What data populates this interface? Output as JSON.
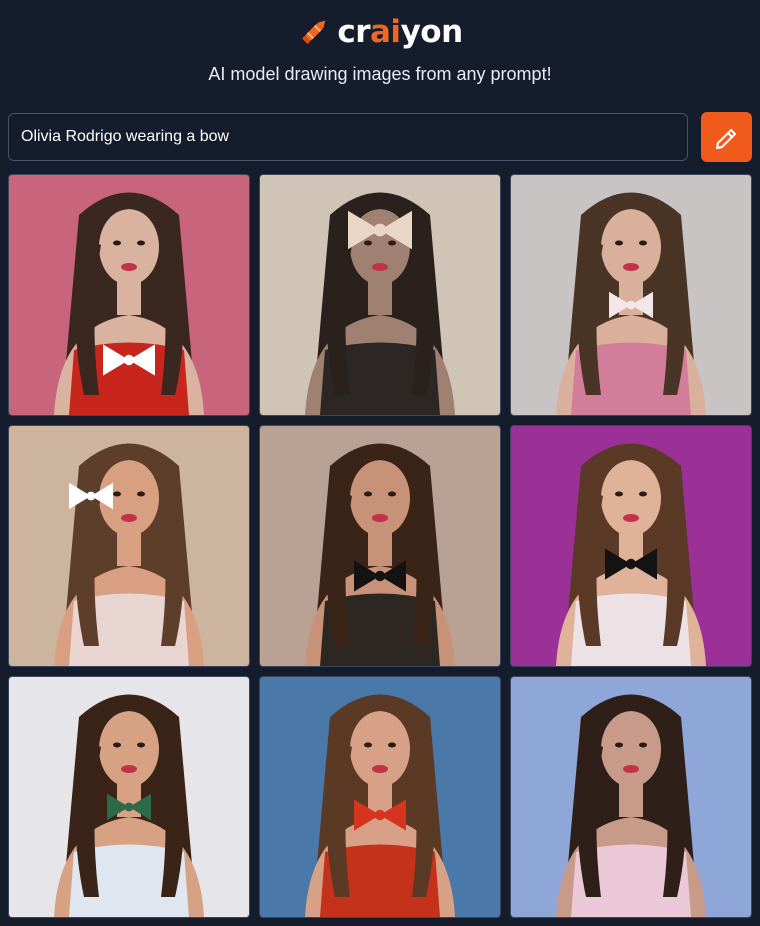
{
  "app": {
    "logo": {
      "part1": "cr",
      "accent": "ai",
      "part2": "yon"
    },
    "tagline": "AI model drawing images from any prompt!"
  },
  "search": {
    "value": "Olivia Rodrigo wearing a bow",
    "placeholder": ""
  },
  "draw_button": {
    "icon": "pencil-icon"
  },
  "colors": {
    "background": "#151c2c",
    "accent": "#f05a1a",
    "input_border": "#49526a"
  },
  "results": [
    {
      "bg": "#c8657c",
      "hair": "#3a2820",
      "skin": "#d9b2a0",
      "top": "#c8261c",
      "bow": "#ffffff",
      "bow_style": "top-bow",
      "icon": "generated-image"
    },
    {
      "bg": "#cfc4b6",
      "hair": "#2a211c",
      "skin": "#a08070",
      "top": "#2c2624",
      "bow": "#ead6c4",
      "bow_style": "face-bow",
      "icon": "generated-image"
    },
    {
      "bg": "#c9c4c4",
      "hair": "#4a3426",
      "skin": "#d9b09c",
      "top": "#d27e9a",
      "bow": "#f3e6e6",
      "bow_style": "neck-bow",
      "icon": "generated-image"
    },
    {
      "bg": "#cdb49e",
      "hair": "#5c3e2a",
      "skin": "#d8a080",
      "top": "#e8d5d2",
      "bow": "#ffffff",
      "bow_style": "side-bow",
      "icon": "generated-image"
    },
    {
      "bg": "#b9a294",
      "hair": "#3a2418",
      "skin": "#c89278",
      "top": "#2e2620",
      "bow": "#141212",
      "bow_style": "chest-bow",
      "icon": "generated-image"
    },
    {
      "bg": "#9b3096",
      "hair": "#5a3a26",
      "skin": "#e0b29a",
      "top": "#ece2e6",
      "bow": "#141212",
      "bow_style": "collar-bow",
      "icon": "generated-image"
    },
    {
      "bg": "#e6e6ea",
      "hair": "#3a2418",
      "skin": "#d7a184",
      "top": "#dfe6f0",
      "bow": "#2e6a4a",
      "bow_style": "neck-bow",
      "icon": "generated-image"
    },
    {
      "bg": "#4a78a8",
      "hair": "#5a3a24",
      "skin": "#d9a088",
      "top": "#c4321c",
      "bow": "#d6341e",
      "bow_style": "collar-bow",
      "icon": "generated-image"
    },
    {
      "bg": "#8fa6d8",
      "hair": "#2e2018",
      "skin": "#c89a8a",
      "top": "#eac8d8",
      "bow": "#e8b6c8",
      "bow_style": "none",
      "icon": "generated-image"
    }
  ]
}
